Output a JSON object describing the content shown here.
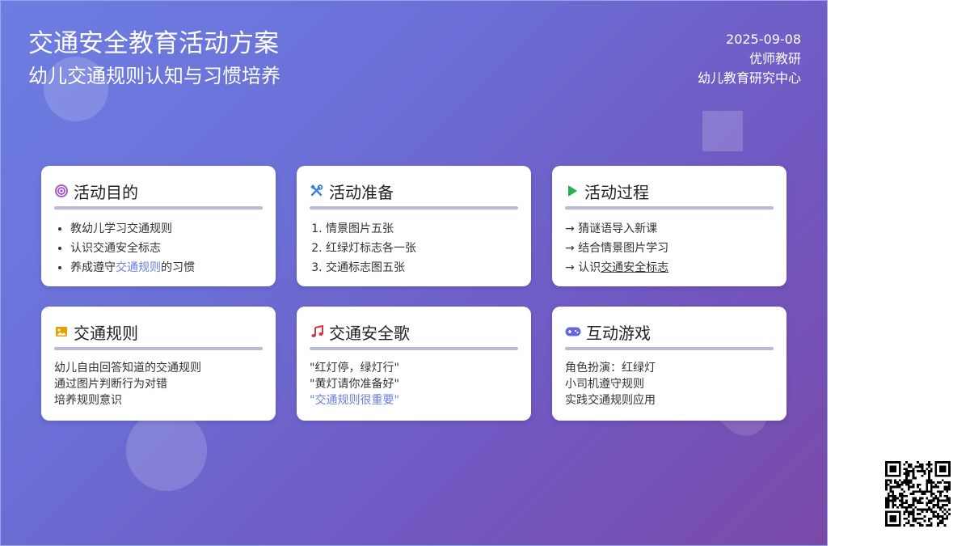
{
  "header": {
    "title": "交通安全教育活动方案",
    "subtitle": "幼儿交通规则认知与习惯培养",
    "date": "2025-09-08",
    "author": "优师教研",
    "org": "幼儿教育研究中心"
  },
  "cards": {
    "goal": {
      "title": "活动目的",
      "icon": "target-icon",
      "items": [
        "教幼儿学习交通规则",
        "认识交通安全标志"
      ],
      "item3_pre": "养成遵守",
      "item3_accent": "交通规则",
      "item3_post": "的习惯"
    },
    "prep": {
      "title": "活动准备",
      "icon": "tools-icon",
      "items": [
        "情景图片五张",
        "红绿灯标志各一张",
        "交通标志图五张"
      ]
    },
    "process": {
      "title": "活动过程",
      "icon": "play-icon",
      "items": [
        "→ 猜谜语导入新课",
        "→ 结合情景图片学习"
      ],
      "item3_pre": "→ 认识",
      "item3_under": "交通安全标志"
    },
    "rules": {
      "title": "交通规则",
      "icon": "image-icon",
      "lines": [
        "幼儿自由回答知道的交通规则",
        "通过图片判断行为对错",
        "培养规则意识"
      ]
    },
    "song": {
      "title": "交通安全歌",
      "icon": "music-icon",
      "lines": [
        "\"红灯停，绿灯行\"",
        "\"黄灯请你准备好\""
      ],
      "accent_line": "\"交通规则很重要\""
    },
    "game": {
      "title": "互动游戏",
      "icon": "gamepad-icon",
      "lines": [
        "角色扮演：红绿灯",
        "小司机遵守规则",
        "实践交通规则应用"
      ]
    }
  },
  "colors": {
    "bg_start": "#6c7ee3",
    "bg_end": "#7a4aa8",
    "accent": "#6a7fdc",
    "goal_icon": "#a04fc9",
    "prep_icon": "#3b82d6",
    "process_icon": "#22b14c",
    "rules_icon": "#e2a200",
    "song_icon": "#d9363e",
    "game_icon": "#6868d8"
  },
  "qr_code": "qr-code"
}
